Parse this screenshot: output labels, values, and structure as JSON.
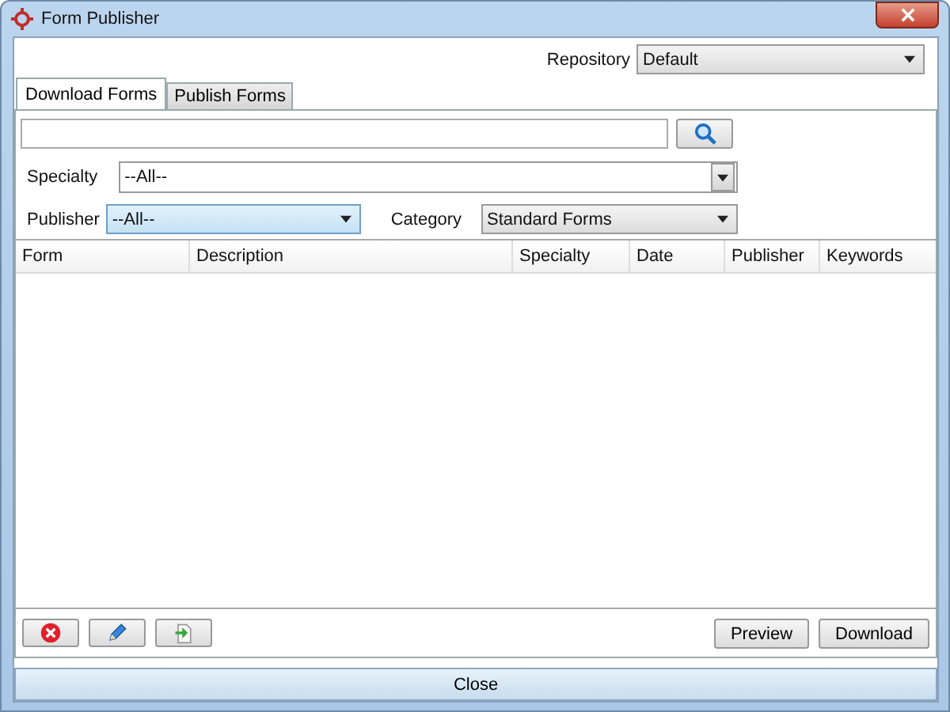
{
  "window": {
    "title": "Form Publisher"
  },
  "repository": {
    "label": "Repository",
    "value": "Default"
  },
  "tabs": [
    {
      "label": "Download Forms",
      "selected": true
    },
    {
      "label": "Publish Forms",
      "selected": false
    }
  ],
  "specialty": {
    "label": "Specialty",
    "value": "--All--"
  },
  "publisher": {
    "label": "Publisher",
    "value": "--All--",
    "focused": true
  },
  "category": {
    "label": "Category",
    "value": "Standard Forms"
  },
  "table": {
    "columns": [
      "Form",
      "Description",
      "Specialty",
      "Date",
      "Publisher",
      "Keywords"
    ]
  },
  "tool_buttons": [
    {
      "kind": "delete"
    },
    {
      "kind": "edit"
    },
    {
      "kind": "import"
    }
  ],
  "action_buttons": [
    "Preview",
    "Download"
  ],
  "close_button": "Close"
}
